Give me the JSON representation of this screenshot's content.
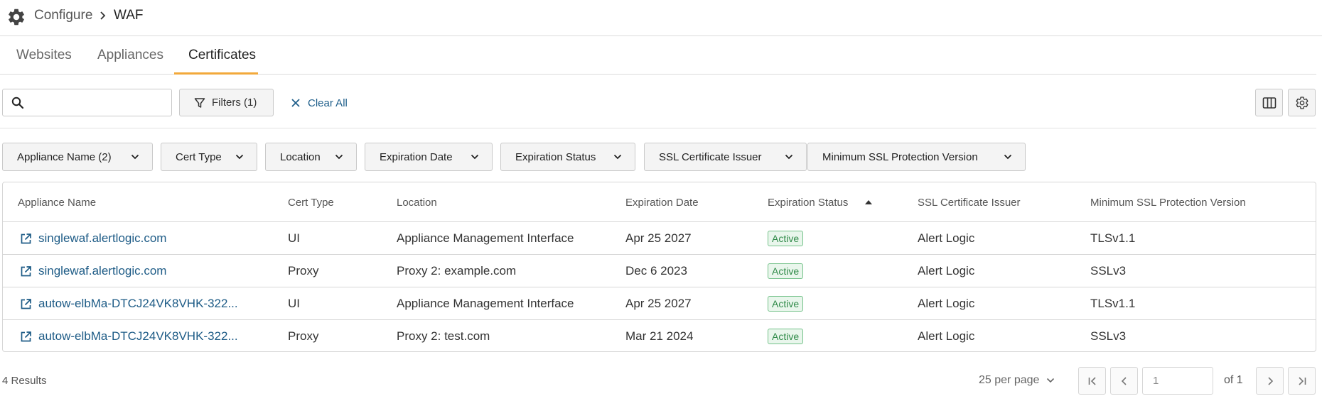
{
  "breadcrumb": {
    "root": "Configure",
    "current": "WAF"
  },
  "tabs": [
    {
      "label": "Websites",
      "active": false
    },
    {
      "label": "Appliances",
      "active": false
    },
    {
      "label": "Certificates",
      "active": true
    }
  ],
  "toolbar": {
    "search_value": "",
    "filters_label": "Filters (1)",
    "clear_all_label": "Clear All",
    "columns_icon": "columns-icon",
    "settings_icon": "gear-icon"
  },
  "filter_chips": [
    "Appliance Name (2)",
    "Cert Type",
    "Location",
    "Expiration Date",
    "Expiration Status",
    "SSL Certificate Issuer",
    "Minimum SSL Protection Version"
  ],
  "table": {
    "columns": [
      "Appliance Name",
      "Cert Type",
      "Location",
      "Expiration Date",
      "Expiration Status",
      "SSL Certificate Issuer",
      "Minimum SSL Protection Version"
    ],
    "sorted_column": "Expiration Status",
    "sort_direction": "ascending",
    "rows": [
      {
        "name": "singlewaf.alertlogic.com",
        "cert_type": "UI",
        "location": "Appliance Management Interface",
        "expiration_date": "Apr 25 2027",
        "status": "Active",
        "issuer": "Alert Logic",
        "min_ssl": "TLSv1.1"
      },
      {
        "name": "singlewaf.alertlogic.com",
        "cert_type": "Proxy",
        "location": "Proxy 2: example.com",
        "expiration_date": "Dec 6 2023",
        "status": "Active",
        "issuer": "Alert Logic",
        "min_ssl": "SSLv3"
      },
      {
        "name": "autow-elbMa-DTCJ24VK8VHK-322...",
        "cert_type": "UI",
        "location": "Appliance Management Interface",
        "expiration_date": "Apr 25 2027",
        "status": "Active",
        "issuer": "Alert Logic",
        "min_ssl": "TLSv1.1"
      },
      {
        "name": "autow-elbMa-DTCJ24VK8VHK-322...",
        "cert_type": "Proxy",
        "location": "Proxy 2: test.com",
        "expiration_date": "Mar 21 2024",
        "status": "Active",
        "issuer": "Alert Logic",
        "min_ssl": "SSLv3"
      }
    ]
  },
  "footer": {
    "results": "4 Results",
    "per_page": "25 per page",
    "page_value": "1",
    "of_pages": "of 1"
  },
  "colors": {
    "accent": "#f2a93b",
    "link": "#1d5b86",
    "active_badge_border": "#74c28a",
    "active_badge_text": "#2f8a48"
  }
}
